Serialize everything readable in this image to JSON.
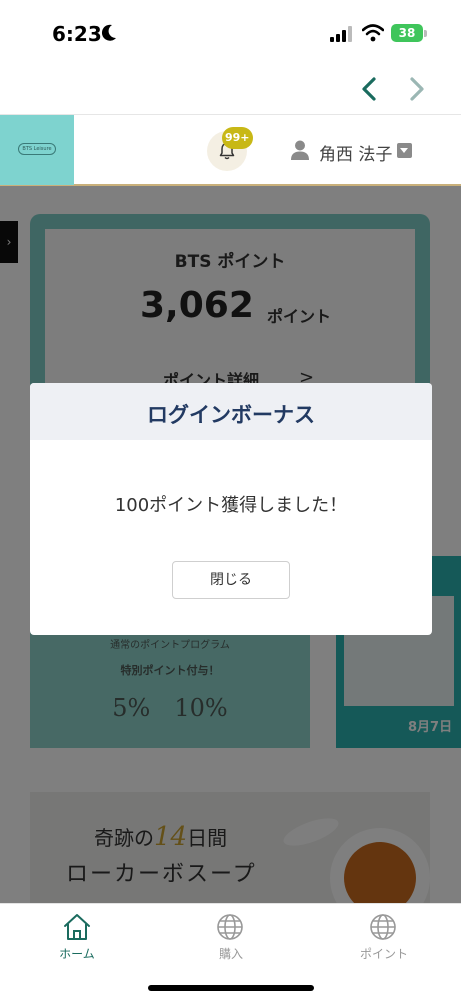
{
  "status_bar": {
    "time": "6:23",
    "battery": "38"
  },
  "header": {
    "logo_text": "BTS Leisure",
    "notification_badge": "99+",
    "user_name": "角西 法子"
  },
  "points_card": {
    "label": "BTS ポイント",
    "value": "3,062",
    "unit": "ポイント",
    "detail_link": "ポイント詳細",
    "detail_arrow": ">"
  },
  "banner_left": {
    "line1": "通常のポイントプログラム",
    "line2": "特別ポイント付与！",
    "line3": "5%　10%"
  },
  "banner_right": {
    "date": "8月7日"
  },
  "soup_banner": {
    "line1_prefix": "奇跡の",
    "line1_number": "14",
    "line1_suffix": "日間",
    "line2": "ローカーボスープ"
  },
  "modal": {
    "title": "ログインボーナス",
    "message": "100ポイント獲得しました！",
    "close_label": "閉じる"
  },
  "tab_bar": {
    "tabs": [
      {
        "label": "ホーム",
        "icon": "home-icon"
      },
      {
        "label": "購入",
        "icon": "globe-icon"
      },
      {
        "label": "ポイント",
        "icon": "globe-icon"
      }
    ]
  },
  "colors": {
    "accent": "#1a6b5e",
    "modal_title": "#223a62",
    "badge": "#c8b816",
    "logo_bg": "#7ed3cf"
  }
}
